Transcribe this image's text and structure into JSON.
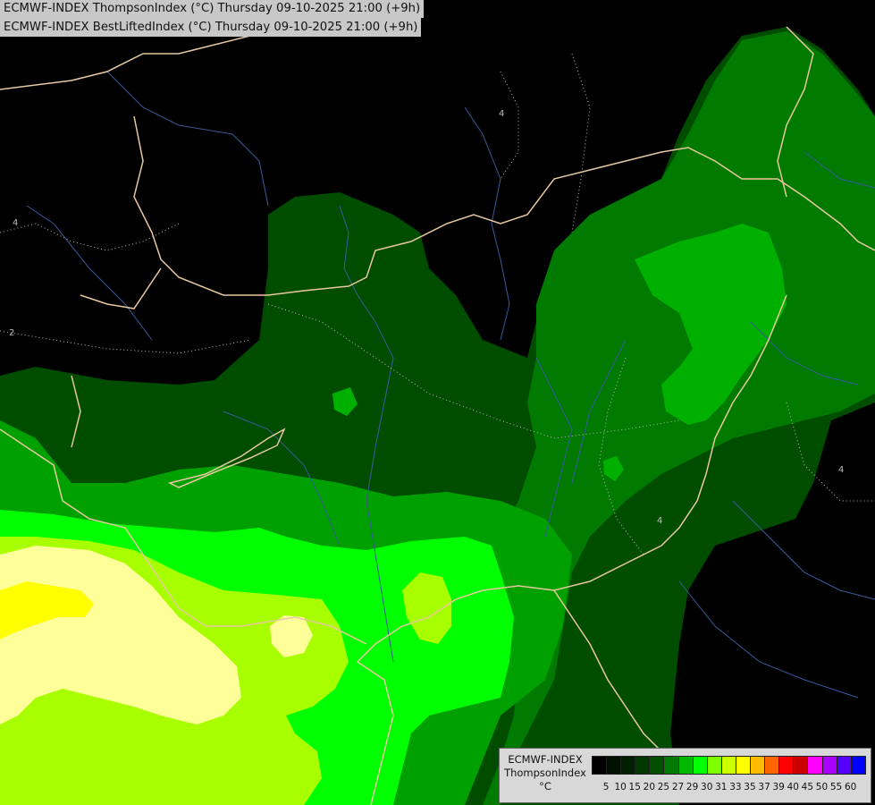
{
  "header": {
    "line1": "ECMWF-INDEX ThompsonIndex (°C) Thursday 09-10-2025 21:00 (+9h)",
    "line2": "ECMWF-INDEX BestLiftedIndex (°C) Thursday 09-10-2025 21:00 (+9h)"
  },
  "legend": {
    "model": "ECMWF-INDEX",
    "parameter": "ThompsonIndex",
    "unit": "°C",
    "labels": [
      "5",
      "10",
      "15",
      "20",
      "25",
      "27",
      "29",
      "30",
      "31",
      "33",
      "35",
      "37",
      "39",
      "40",
      "45",
      "50",
      "55",
      "60"
    ],
    "colors": [
      "#000000",
      "#001000",
      "#002000",
      "#003800",
      "#005000",
      "#007a00",
      "#00b800",
      "#00ff00",
      "#80ff00",
      "#ccff00",
      "#ffff00",
      "#ffbb00",
      "#ff6600",
      "#ff0000",
      "#cc0000",
      "#ff00ff",
      "#aa00ff",
      "#5500ff",
      "#0000ff"
    ]
  },
  "contour_labels": [
    "4",
    "4",
    "2",
    "4",
    "4"
  ],
  "fill_colors": {
    "dark_green": "#004d00",
    "green": "#008800",
    "bright_green": "#00cc00",
    "lime": "#00ff00",
    "yellow_green": "#a8ff00",
    "pale_yellow": "#ffff88",
    "yellow": "#ffff00",
    "border": "#e8c8a0",
    "river": "#3a5a9a"
  }
}
